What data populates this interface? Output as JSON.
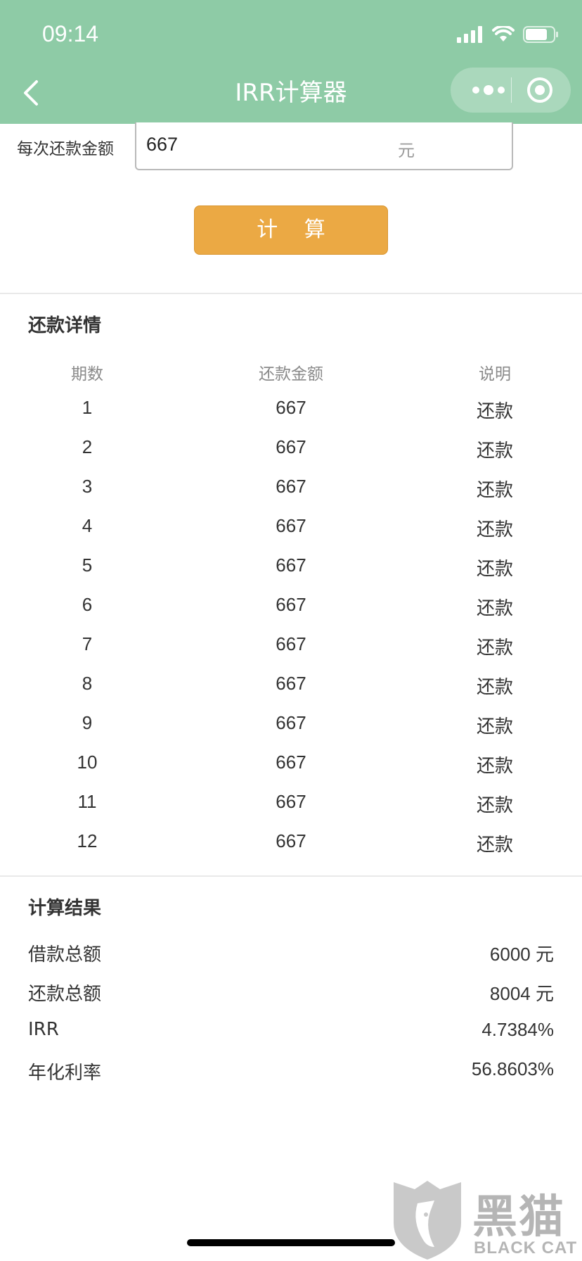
{
  "status_bar": {
    "time": "09:14"
  },
  "nav": {
    "title": "IRR计算器"
  },
  "form": {
    "label": "每次还款金额",
    "value": "667",
    "unit": "元"
  },
  "calc_button": "计 算",
  "details": {
    "title": "还款详情",
    "headers": [
      "期数",
      "还款金额",
      "说明"
    ],
    "rows": [
      [
        "1",
        "667",
        "还款"
      ],
      [
        "2",
        "667",
        "还款"
      ],
      [
        "3",
        "667",
        "还款"
      ],
      [
        "4",
        "667",
        "还款"
      ],
      [
        "5",
        "667",
        "还款"
      ],
      [
        "6",
        "667",
        "还款"
      ],
      [
        "7",
        "667",
        "还款"
      ],
      [
        "8",
        "667",
        "还款"
      ],
      [
        "9",
        "667",
        "还款"
      ],
      [
        "10",
        "667",
        "还款"
      ],
      [
        "11",
        "667",
        "还款"
      ],
      [
        "12",
        "667",
        "还款"
      ]
    ]
  },
  "results": {
    "title": "计算结果",
    "items": [
      {
        "label": "借款总额",
        "value": "6000 元"
      },
      {
        "label": "还款总额",
        "value": "8004 元"
      },
      {
        "label": "IRR",
        "value": "4.7384%"
      },
      {
        "label": "年化利率",
        "value": "56.8603%"
      }
    ]
  },
  "watermark": {
    "text": "黑猫",
    "sub": "BLACK CAT"
  },
  "colors": {
    "header": "#8ecba6",
    "button": "#eba944"
  }
}
